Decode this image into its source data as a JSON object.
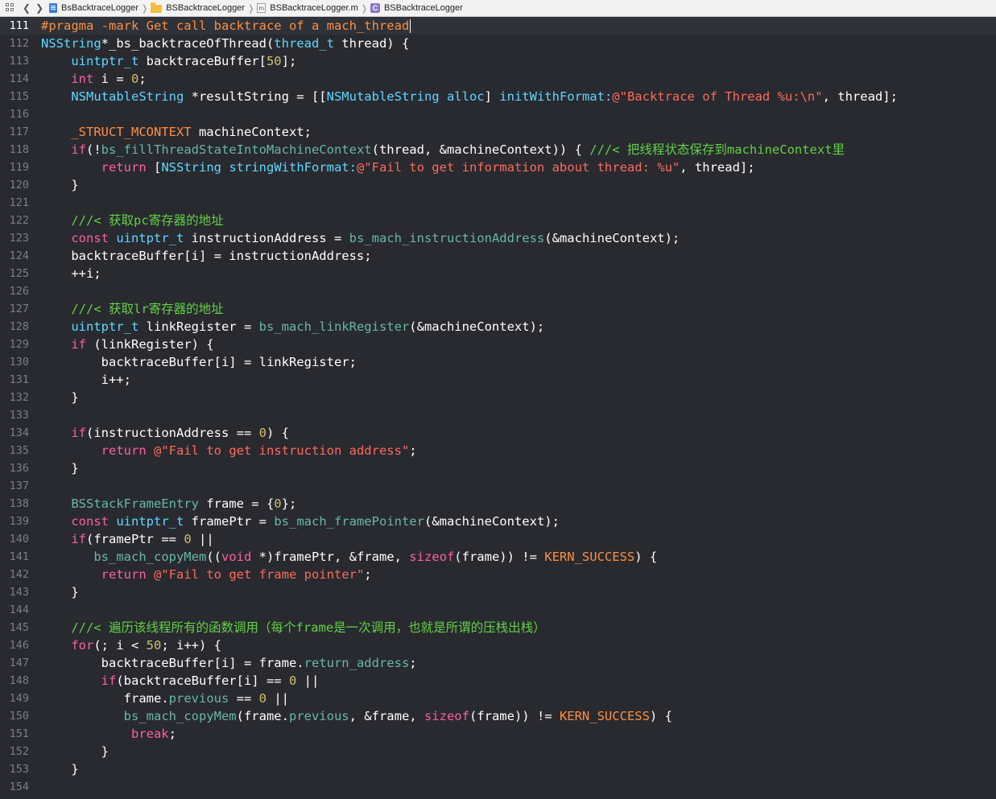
{
  "breadcrumb": {
    "items": [
      {
        "label": "BsBacktraceLogger",
        "icon": "project-icon"
      },
      {
        "label": "BSBacktraceLogger",
        "icon": "folder-icon"
      },
      {
        "label": "BSBacktraceLogger.m",
        "icon": "m-file-icon"
      },
      {
        "label": "BSBacktraceLogger",
        "icon": "class-icon"
      }
    ]
  },
  "editor": {
    "current_line": 111,
    "lines": [
      {
        "n": 111,
        "ind": 0,
        "tokens": [
          [
            "pp",
            "#pragma -mark Get call backtrace of a mach_thread"
          ]
        ]
      },
      {
        "n": 112,
        "ind": 0,
        "tokens": [
          [
            "t",
            "NSString"
          ],
          [
            "",
            "*_bs_backtraceOfThread("
          ],
          [
            "t",
            "thread_t"
          ],
          [
            "",
            " thread) {"
          ]
        ]
      },
      {
        "n": 113,
        "ind": 4,
        "tokens": [
          [
            "t",
            "uintptr_t"
          ],
          [
            "",
            " backtraceBuffer["
          ],
          [
            "n",
            "50"
          ],
          [
            "",
            "];"
          ]
        ]
      },
      {
        "n": 114,
        "ind": 4,
        "tokens": [
          [
            "k",
            "int"
          ],
          [
            "",
            " i = "
          ],
          [
            "n",
            "0"
          ],
          [
            "",
            ";"
          ]
        ]
      },
      {
        "n": 115,
        "ind": 4,
        "tokens": [
          [
            "t",
            "NSMutableString"
          ],
          [
            "",
            " *resultString = [["
          ],
          [
            "t",
            "NSMutableString"
          ],
          [
            "",
            " "
          ],
          [
            "t",
            "alloc"
          ],
          [
            "",
            "] "
          ],
          [
            "t",
            "initWithFormat:"
          ],
          [
            "s",
            "@\"Backtrace of Thread %u:\\n\""
          ],
          [
            "",
            ", thread];"
          ]
        ]
      },
      {
        "n": 116,
        "ind": 0,
        "tokens": []
      },
      {
        "n": 117,
        "ind": 4,
        "tokens": [
          [
            "mac",
            "_STRUCT_MCONTEXT"
          ],
          [
            "",
            " machineContext;"
          ]
        ]
      },
      {
        "n": 118,
        "ind": 4,
        "tokens": [
          [
            "k",
            "if"
          ],
          [
            "",
            "(!"
          ],
          [
            "f",
            "bs_fillThreadStateIntoMachineContext"
          ],
          [
            "",
            "(thread, &machineContext)) { "
          ],
          [
            "cm",
            "///< 把线程状态保存到machineContext里"
          ]
        ]
      },
      {
        "n": 119,
        "ind": 8,
        "tokens": [
          [
            "k",
            "return"
          ],
          [
            "",
            " ["
          ],
          [
            "t",
            "NSString"
          ],
          [
            "",
            " "
          ],
          [
            "t",
            "stringWithFormat:"
          ],
          [
            "s",
            "@\"Fail to get information about thread: %u\""
          ],
          [
            "",
            ", thread];"
          ]
        ]
      },
      {
        "n": 120,
        "ind": 4,
        "tokens": [
          [
            "",
            "}"
          ]
        ]
      },
      {
        "n": 121,
        "ind": 0,
        "tokens": []
      },
      {
        "n": 122,
        "ind": 4,
        "tokens": [
          [
            "cm",
            "///< 获取pc寄存器的地址"
          ]
        ]
      },
      {
        "n": 123,
        "ind": 4,
        "tokens": [
          [
            "k",
            "const"
          ],
          [
            "",
            " "
          ],
          [
            "t",
            "uintptr_t"
          ],
          [
            "",
            " instructionAddress = "
          ],
          [
            "f",
            "bs_mach_instructionAddress"
          ],
          [
            "",
            "(&machineContext);"
          ]
        ]
      },
      {
        "n": 124,
        "ind": 4,
        "tokens": [
          [
            "",
            "backtraceBuffer[i] = instructionAddress;"
          ]
        ]
      },
      {
        "n": 125,
        "ind": 4,
        "tokens": [
          [
            "",
            "++i;"
          ]
        ]
      },
      {
        "n": 126,
        "ind": 0,
        "tokens": []
      },
      {
        "n": 127,
        "ind": 4,
        "tokens": [
          [
            "cm",
            "///< 获取lr寄存器的地址"
          ]
        ]
      },
      {
        "n": 128,
        "ind": 4,
        "tokens": [
          [
            "t",
            "uintptr_t"
          ],
          [
            "",
            " linkRegister = "
          ],
          [
            "f",
            "bs_mach_linkRegister"
          ],
          [
            "",
            "(&machineContext);"
          ]
        ]
      },
      {
        "n": 129,
        "ind": 4,
        "tokens": [
          [
            "k",
            "if"
          ],
          [
            "",
            " (linkRegister) {"
          ]
        ]
      },
      {
        "n": 130,
        "ind": 8,
        "tokens": [
          [
            "",
            "backtraceBuffer[i] = linkRegister;"
          ]
        ]
      },
      {
        "n": 131,
        "ind": 8,
        "tokens": [
          [
            "",
            "i++;"
          ]
        ]
      },
      {
        "n": 132,
        "ind": 4,
        "tokens": [
          [
            "",
            "}"
          ]
        ]
      },
      {
        "n": 133,
        "ind": 0,
        "tokens": []
      },
      {
        "n": 134,
        "ind": 4,
        "tokens": [
          [
            "k",
            "if"
          ],
          [
            "",
            "(instructionAddress == "
          ],
          [
            "n",
            "0"
          ],
          [
            "",
            ") {"
          ]
        ]
      },
      {
        "n": 135,
        "ind": 8,
        "tokens": [
          [
            "k",
            "return"
          ],
          [
            "",
            " "
          ],
          [
            "s",
            "@\"Fail to get instruction address\""
          ],
          [
            "",
            ";"
          ]
        ]
      },
      {
        "n": 136,
        "ind": 4,
        "tokens": [
          [
            "",
            "}"
          ]
        ]
      },
      {
        "n": 137,
        "ind": 0,
        "tokens": []
      },
      {
        "n": 138,
        "ind": 4,
        "tokens": [
          [
            "f",
            "BSStackFrameEntry"
          ],
          [
            "",
            " frame = {"
          ],
          [
            "n",
            "0"
          ],
          [
            "",
            "};"
          ]
        ]
      },
      {
        "n": 139,
        "ind": 4,
        "tokens": [
          [
            "k",
            "const"
          ],
          [
            "",
            " "
          ],
          [
            "t",
            "uintptr_t"
          ],
          [
            "",
            " framePtr = "
          ],
          [
            "f",
            "bs_mach_framePointer"
          ],
          [
            "",
            "(&machineContext);"
          ]
        ]
      },
      {
        "n": 140,
        "ind": 4,
        "tokens": [
          [
            "k",
            "if"
          ],
          [
            "",
            "(framePtr == "
          ],
          [
            "n",
            "0"
          ],
          [
            "",
            " ||"
          ]
        ]
      },
      {
        "n": 141,
        "ind": 7,
        "tokens": [
          [
            "f",
            "bs_mach_copyMem"
          ],
          [
            "",
            "(("
          ],
          [
            "k",
            "void"
          ],
          [
            "",
            " *)framePtr, &frame, "
          ],
          [
            "k",
            "sizeof"
          ],
          [
            "",
            "(frame)) != "
          ],
          [
            "mac",
            "KERN_SUCCESS"
          ],
          [
            "",
            ") {"
          ]
        ]
      },
      {
        "n": 142,
        "ind": 8,
        "tokens": [
          [
            "k",
            "return"
          ],
          [
            "",
            " "
          ],
          [
            "s",
            "@\"Fail to get frame pointer\""
          ],
          [
            "",
            ";"
          ]
        ]
      },
      {
        "n": 143,
        "ind": 4,
        "tokens": [
          [
            "",
            "}"
          ]
        ]
      },
      {
        "n": 144,
        "ind": 0,
        "tokens": []
      },
      {
        "n": 145,
        "ind": 4,
        "tokens": [
          [
            "cm",
            "///< 遍历该线程所有的函数调用（每个frame是一次调用，也就是所谓的压栈出栈）"
          ]
        ]
      },
      {
        "n": 146,
        "ind": 4,
        "tokens": [
          [
            "k",
            "for"
          ],
          [
            "",
            "(; i < "
          ],
          [
            "n",
            "50"
          ],
          [
            "",
            "; i++) {"
          ]
        ]
      },
      {
        "n": 147,
        "ind": 8,
        "tokens": [
          [
            "",
            "backtraceBuffer[i] = frame."
          ],
          [
            "f",
            "return_address"
          ],
          [
            "",
            ";"
          ]
        ]
      },
      {
        "n": 148,
        "ind": 8,
        "tokens": [
          [
            "k",
            "if"
          ],
          [
            "",
            "(backtraceBuffer[i] == "
          ],
          [
            "n",
            "0"
          ],
          [
            "",
            " ||"
          ]
        ]
      },
      {
        "n": 149,
        "ind": 11,
        "tokens": [
          [
            "",
            "frame."
          ],
          [
            "f",
            "previous"
          ],
          [
            "",
            " == "
          ],
          [
            "n",
            "0"
          ],
          [
            "",
            " ||"
          ]
        ]
      },
      {
        "n": 150,
        "ind": 11,
        "tokens": [
          [
            "f",
            "bs_mach_copyMem"
          ],
          [
            "",
            "(frame."
          ],
          [
            "f",
            "previous"
          ],
          [
            "",
            ", &frame, "
          ],
          [
            "k",
            "sizeof"
          ],
          [
            "",
            "(frame)) != "
          ],
          [
            "mac",
            "KERN_SUCCESS"
          ],
          [
            "",
            ") {"
          ]
        ]
      },
      {
        "n": 151,
        "ind": 12,
        "tokens": [
          [
            "k",
            "break"
          ],
          [
            "",
            ";"
          ]
        ]
      },
      {
        "n": 152,
        "ind": 8,
        "tokens": [
          [
            "",
            "}"
          ]
        ]
      },
      {
        "n": 153,
        "ind": 4,
        "tokens": [
          [
            "",
            "}"
          ]
        ]
      },
      {
        "n": 154,
        "ind": 0,
        "tokens": []
      }
    ]
  }
}
